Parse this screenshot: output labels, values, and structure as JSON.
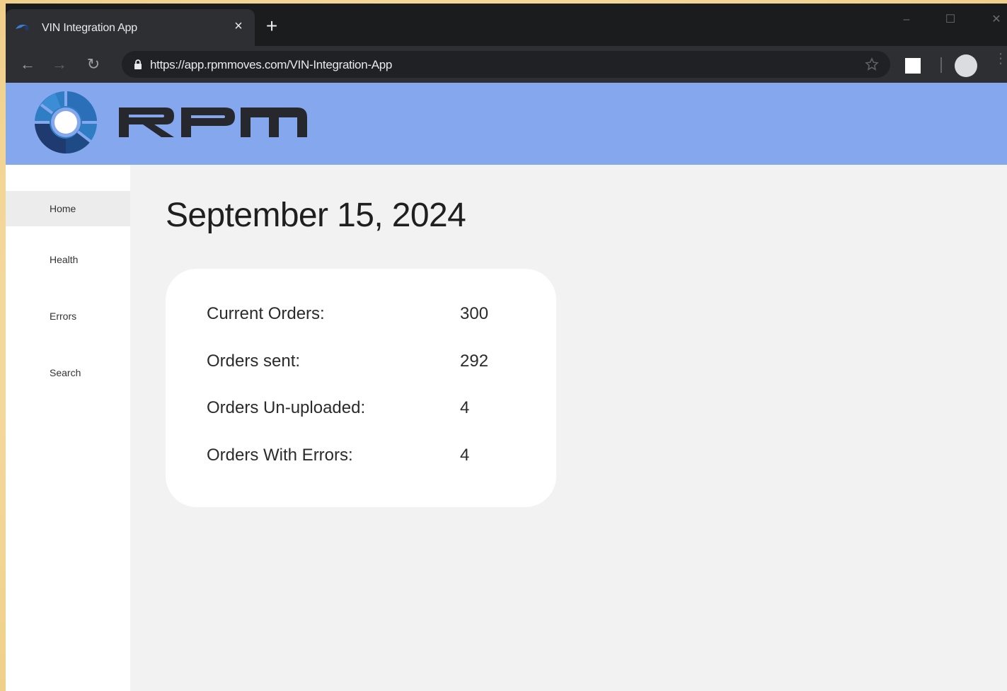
{
  "browser": {
    "tab_title": "VIN Integration App",
    "tab_close": "×",
    "new_tab": "+",
    "url": "https://app.rpmmoves.com/VIN-Integration-App",
    "window_controls": {
      "minimize": "–",
      "maximize": "☐",
      "close": "✕"
    },
    "nav": {
      "back": "←",
      "forward": "→",
      "reload": "↻"
    }
  },
  "header": {
    "brand": "RPM",
    "colors": {
      "header_bg": "#85a7ee",
      "logo_dark": "#1e3a6e",
      "logo_light": "#2f7dc2",
      "wordmark": "#26282e"
    }
  },
  "sidebar": {
    "items": [
      {
        "label": "Home",
        "active": true
      },
      {
        "label": "Health",
        "active": false
      },
      {
        "label": "Errors",
        "active": false
      },
      {
        "label": "Search",
        "active": false
      }
    ]
  },
  "main": {
    "date": "September 15, 2024",
    "stats": [
      {
        "label": "Current Orders:",
        "value": "300"
      },
      {
        "label": "Orders sent:",
        "value": "292"
      },
      {
        "label": "Orders Un-uploaded:",
        "value": "4"
      },
      {
        "label": "Orders With Errors:",
        "value": "4"
      }
    ]
  }
}
